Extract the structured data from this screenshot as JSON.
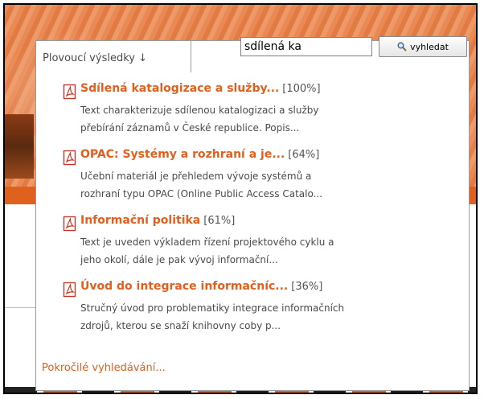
{
  "header": {
    "tab_label": "Plovoucí výsledky ↓",
    "search_value": "sdílená ka",
    "search_button_label": "vyhledat"
  },
  "results": [
    {
      "title": "Sdílená katalogizace a služby...",
      "score": "[100%]",
      "desc_line1": "Text charakterizuje sdílenou katalogizaci a služby",
      "desc_line2": "přebírání záznamů v České republice. Popis..."
    },
    {
      "title": "OPAC: Systémy a rozhraní a je...",
      "score": "[64%]",
      "desc_line1": "Učební materiál je přehledem vývoje systémů a",
      "desc_line2": "rozhraní typu OPAC (Online Public Access Catalo..."
    },
    {
      "title": "Informační politika",
      "score": "[61%]",
      "desc_line1": "Text je uveden výkladem řízení projektového cyklu a",
      "desc_line2": "jeho okolí, dále je pak vývoj informační..."
    },
    {
      "title": "Úvod do integrace informačníc...",
      "score": "[36%]",
      "desc_line1": "Stručný úvod pro problematiky integrace informačních",
      "desc_line2": "zdrojů, kterou se snaží knihovny coby p..."
    }
  ],
  "advanced_link": "Pokročilé vyhledávání...",
  "colors": {
    "accent": "#e0601e",
    "text": "#4a4a4a",
    "border": "#9a9a9a"
  },
  "icons": {
    "result": "pdf-icon",
    "search": "magnifier-icon"
  }
}
